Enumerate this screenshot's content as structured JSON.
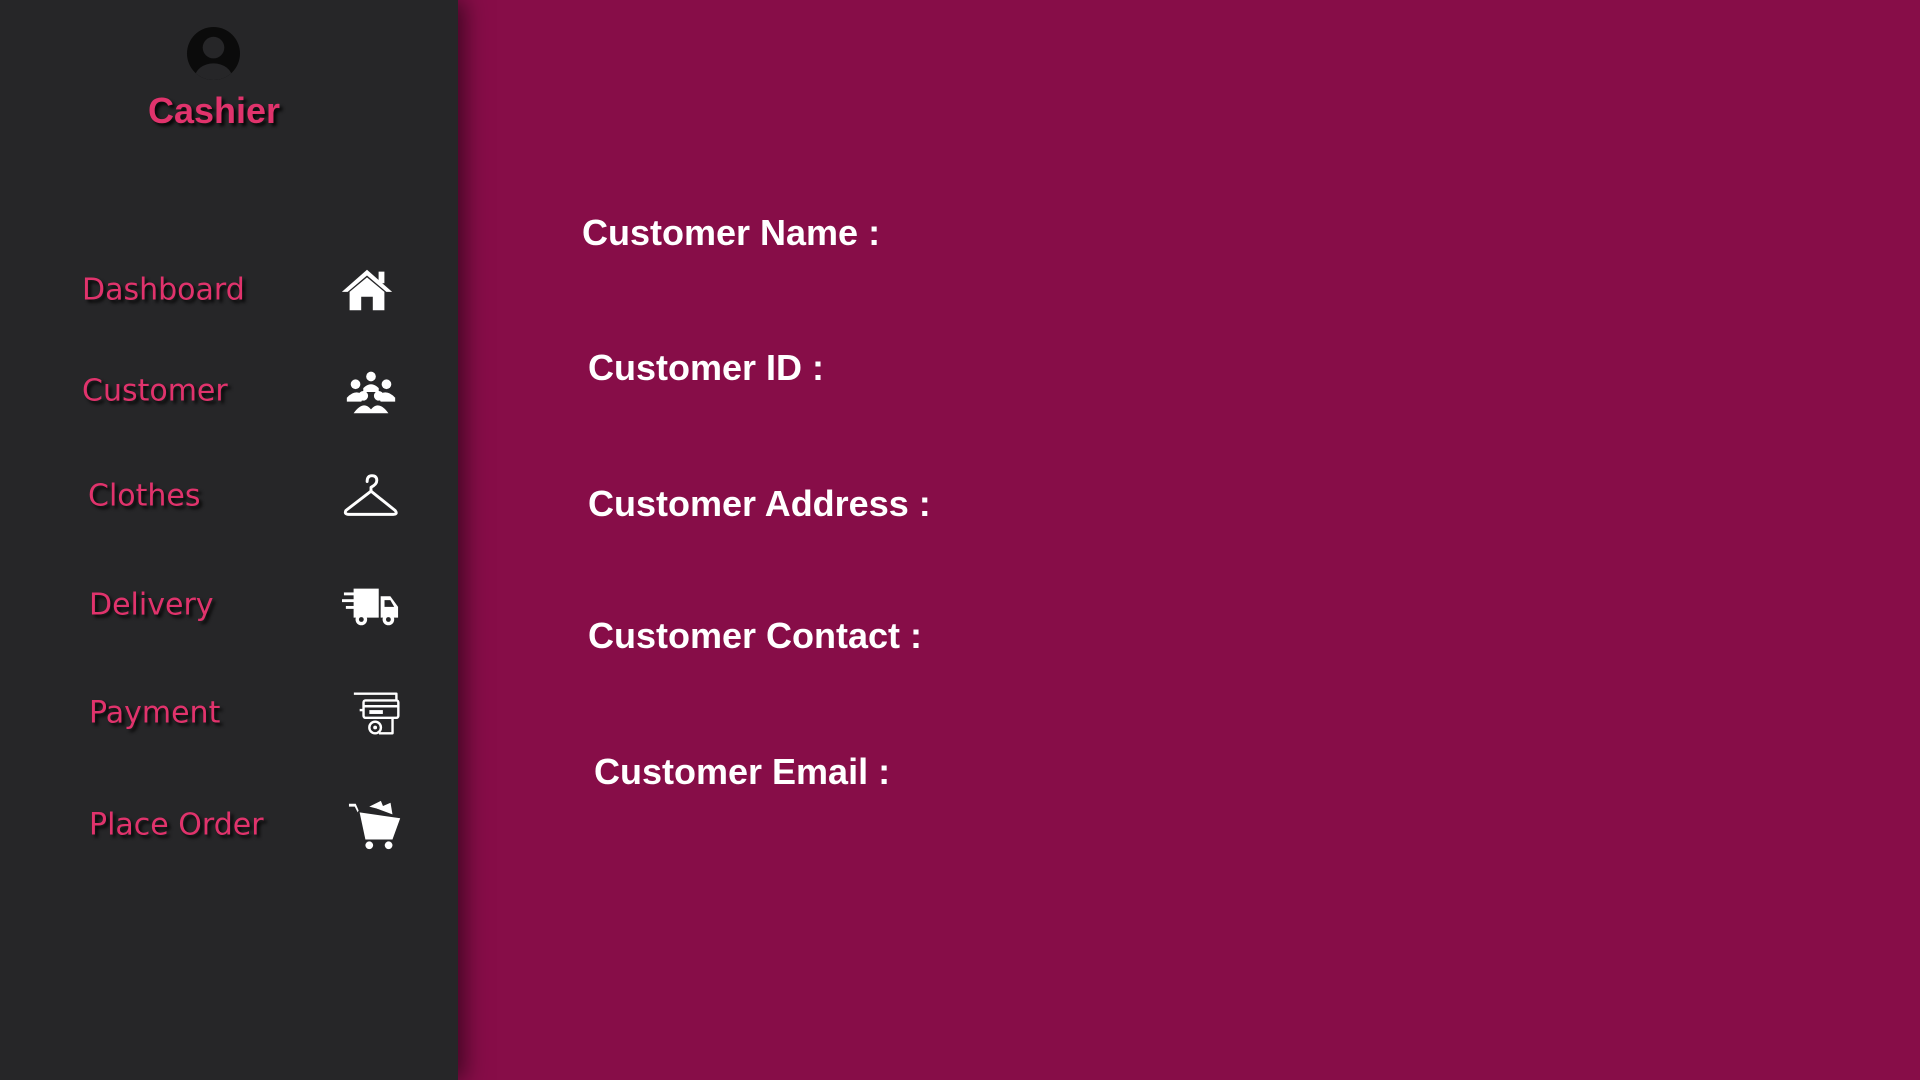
{
  "sidebar": {
    "role_title": "Cashier",
    "avatar_icon": "user-avatar-icon",
    "items": [
      {
        "label": "Dashboard",
        "icon": "home-icon"
      },
      {
        "label": "Customer",
        "icon": "users-group-icon"
      },
      {
        "label": "Clothes",
        "icon": "hanger-icon"
      },
      {
        "label": "Delivery",
        "icon": "delivery-truck-icon"
      },
      {
        "label": "Payment",
        "icon": "payment-card-icon"
      },
      {
        "label": "Place Order",
        "icon": "shopping-cart-icon"
      }
    ]
  },
  "main": {
    "fields": [
      {
        "label": "Customer Name :"
      },
      {
        "label": "Customer ID :"
      },
      {
        "label": "Customer Address :"
      },
      {
        "label": "Customer Contact :"
      },
      {
        "label": "Customer Email :"
      }
    ]
  },
  "colors": {
    "sidebar_background": "#262628",
    "main_background": "#870d48",
    "accent_text": "#e0336c",
    "field_text": "#ffffff"
  }
}
